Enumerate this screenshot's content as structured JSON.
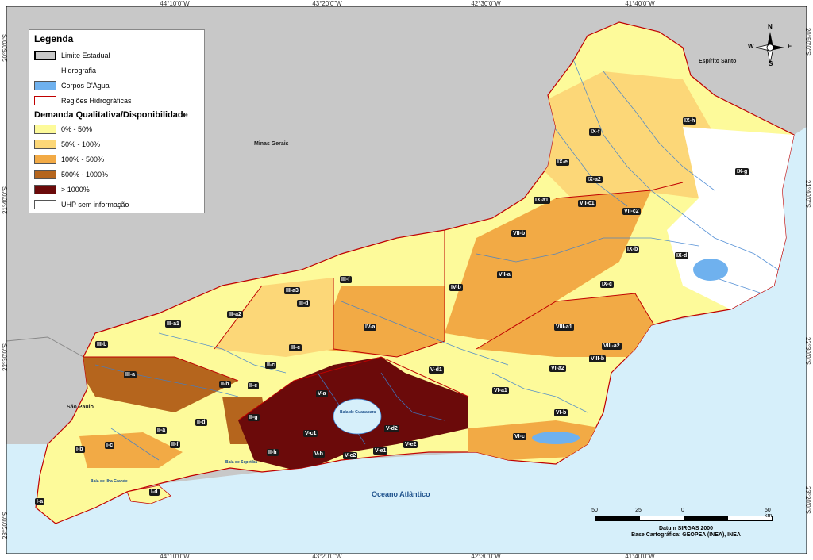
{
  "coords": {
    "top": [
      "44°10'0\"W",
      "43°20'0\"W",
      "42°30'0\"W",
      "41°40'0\"W"
    ],
    "bottom": [
      "44°10'0\"W",
      "43°20'0\"W",
      "42°30'0\"W",
      "41°40'0\"W"
    ],
    "left": [
      "20°50'0\"S",
      "21°40'0\"S",
      "22°30'0\"S",
      "23°20'0\"S"
    ],
    "right": [
      "20°50'0\"S",
      "21°40'0\"S",
      "22°30'0\"S",
      "23°20'0\"S"
    ]
  },
  "places": {
    "minas": "Minas Gerais",
    "espirito": "Espírito Santo",
    "saopaulo": "São Paulo",
    "ocean": "Oceano Atlântico",
    "bay_guanabara": "Baía de Guanabara",
    "bay_sepetiba": "Baía de Sepetiba",
    "bay_ilha": "Baía de Ilha Grande"
  },
  "legend": {
    "title": "Legenda",
    "items": [
      {
        "label": "Limite Estadual",
        "color": "#c8c8c8"
      },
      {
        "label": "Hidrografia",
        "color": "#3a7fd0"
      },
      {
        "label": "Corpos D'Água",
        "color": "#6fb1ee"
      },
      {
        "label": "Regiões Hidrográficas",
        "color": "#c00000"
      }
    ],
    "subtitle": "Demanda Qualitativa/Disponibilidade",
    "classes": [
      {
        "label": "0% - 50%",
        "color": "#fdfa9a"
      },
      {
        "label": "50% - 100%",
        "color": "#fcd778"
      },
      {
        "label": "100% - 500%",
        "color": "#f2aa45"
      },
      {
        "label": "500% - 1000%",
        "color": "#b5651d"
      },
      {
        "label": "> 1000%",
        "color": "#6b0a0a"
      },
      {
        "label": "UHP sem informação",
        "color": "#ffffff"
      }
    ]
  },
  "compass": {
    "n": "N",
    "s": "S",
    "e": "E",
    "w": "W"
  },
  "scale": {
    "ticks": [
      "50",
      "25",
      "0",
      "50 km"
    ],
    "datum": "Datum SIRGAS 2000",
    "base": "Base Cartográfica: GEOPEA (INEA), INEA"
  },
  "uhp_labels": [
    "I-a",
    "I-b",
    "I-c",
    "I-d",
    "II-a",
    "II-b",
    "II-c",
    "II-d",
    "II-e",
    "II-f",
    "II-g",
    "II-h",
    "III-a",
    "III-a1",
    "III-a2",
    "III-a3",
    "III-b",
    "III-c",
    "III-d",
    "III-f",
    "IV-a",
    "IV-b",
    "V-a",
    "V-b",
    "V-c1",
    "V-c2",
    "V-d1",
    "V-d2",
    "V-e1",
    "V-e2",
    "VI-a1",
    "VI-a2",
    "VI-b",
    "VI-c",
    "VII-a",
    "VII-b",
    "VII-c1",
    "VII-c2",
    "VIII-a1",
    "VIII-a2",
    "VIII-b",
    "IX-a1",
    "IX-a2",
    "IX-b",
    "IX-c",
    "IX-d",
    "IX-e",
    "IX-f",
    "IX-g",
    "IX-h"
  ]
}
